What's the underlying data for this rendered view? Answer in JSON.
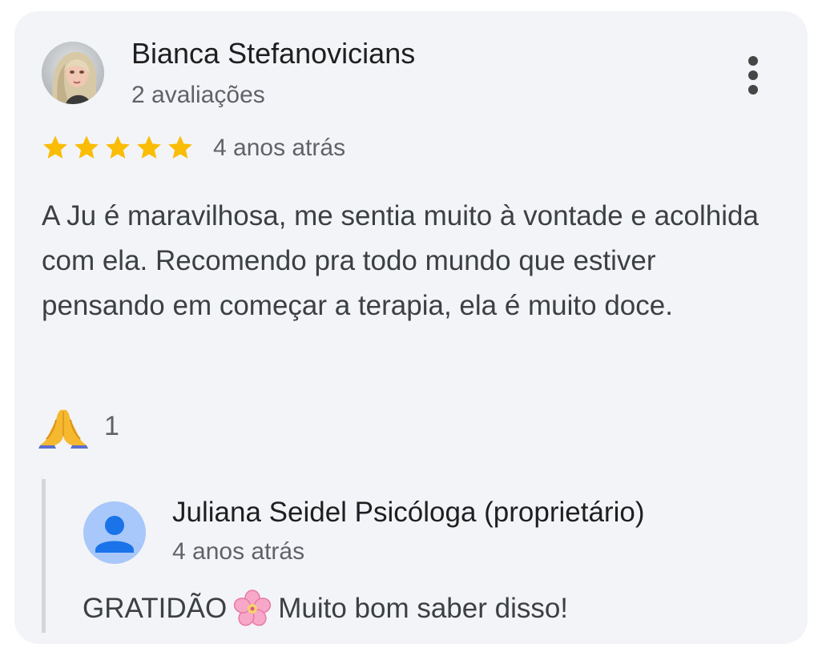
{
  "review": {
    "author": {
      "name": "Bianca Stefanovicians",
      "meta": "2 avaliações",
      "avatar_icon": "profile-photo"
    },
    "more_icon": "more-vert-icon",
    "rating": {
      "stars": 5,
      "max": 5,
      "color": "#fbbc04"
    },
    "time": "4 anos atrás",
    "text": "A Ju é maravilhosa, me sentia muito à vontade e acolhida com ela. Recomendo pra todo mundo que estiver pensando em começar a terapia, ela é muito doce.",
    "reaction": {
      "icon": "folded-hands-emoji",
      "count": "1"
    }
  },
  "owner_reply": {
    "name": "Juliana Seidel Psicóloga (proprietário)",
    "time": "4 anos atrás",
    "avatar_icon": "person-icon",
    "avatar_color": "#a8c7fa",
    "text_before": "GRATIDÃO",
    "emoji_icon": "cherry-blossom-emoji",
    "text_after": "Muito bom saber disso!"
  }
}
